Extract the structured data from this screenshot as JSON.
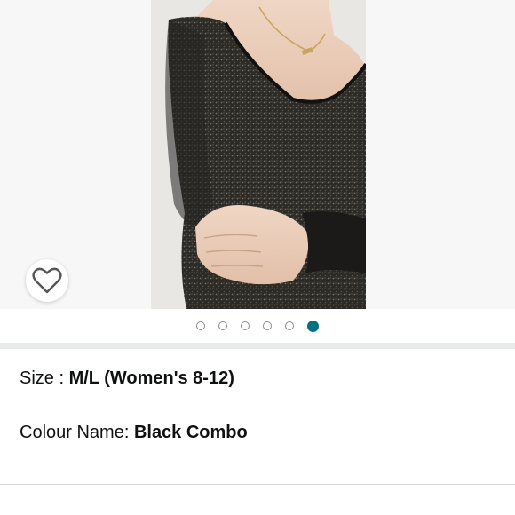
{
  "gallery": {
    "slide_count": 6,
    "active_index": 5,
    "wishlist_icon": "heart-outline-icon"
  },
  "details": {
    "size_label": "Size : ",
    "size_value": "M/L (Women's 8-12)",
    "colour_label": "Colour Name: ",
    "colour_value": "Black Combo"
  },
  "colors": {
    "accent": "#007185",
    "gallery_bg": "#f7f7f7",
    "separator": "#e9ebeb"
  }
}
